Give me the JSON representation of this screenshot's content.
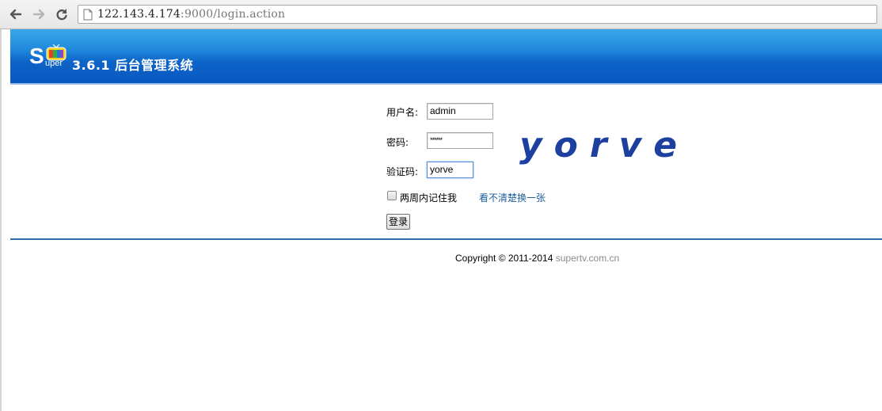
{
  "browser": {
    "url_host": "122.143.4.174",
    "url_rest": ":9000/login.action"
  },
  "header": {
    "logo_s": "S",
    "logo_uper": "uper",
    "title": "3.6.1 后台管理系统"
  },
  "login": {
    "username_label": "用户名:",
    "username_value": "admin",
    "password_label": "密码:",
    "password_value": "******",
    "captcha_label": "验证码:",
    "captcha_value": "yorve",
    "captcha_image_text": "yorve",
    "remember_label": "两周内记住我",
    "refresh_captcha_link": "看不清楚换一张",
    "submit_label": "登录"
  },
  "footer": {
    "copyright": "Copyright © 2011-2014",
    "site": "supertv.com.cn"
  }
}
